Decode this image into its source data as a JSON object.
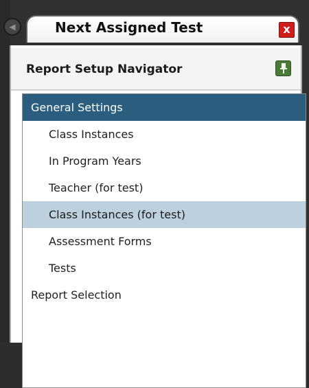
{
  "tab": {
    "title": "Next Assigned Test",
    "close_label": "x"
  },
  "panel": {
    "title": "Report Setup Navigator"
  },
  "navigator": {
    "items": [
      {
        "label": "General Settings",
        "kind": "group",
        "state": "active"
      },
      {
        "label": "Class Instances",
        "kind": "child",
        "state": "normal"
      },
      {
        "label": "In Program Years",
        "kind": "child",
        "state": "normal"
      },
      {
        "label": "Teacher (for test)",
        "kind": "child",
        "state": "normal"
      },
      {
        "label": "Class Instances (for test)",
        "kind": "child",
        "state": "selected"
      },
      {
        "label": "Assessment Forms",
        "kind": "child",
        "state": "normal"
      },
      {
        "label": "Tests",
        "kind": "child",
        "state": "normal"
      },
      {
        "label": "Report Selection",
        "kind": "group",
        "state": "normal"
      }
    ]
  },
  "colors": {
    "active_group_bg": "#2b5e7e",
    "selected_bg": "#bcd0de",
    "pin_green": "#4a7b36",
    "close_red": "#cf1d1d"
  },
  "icons": {
    "tab_back": "circle-left-arrow-icon",
    "tab_close": "close-icon",
    "pin": "pin-icon"
  }
}
